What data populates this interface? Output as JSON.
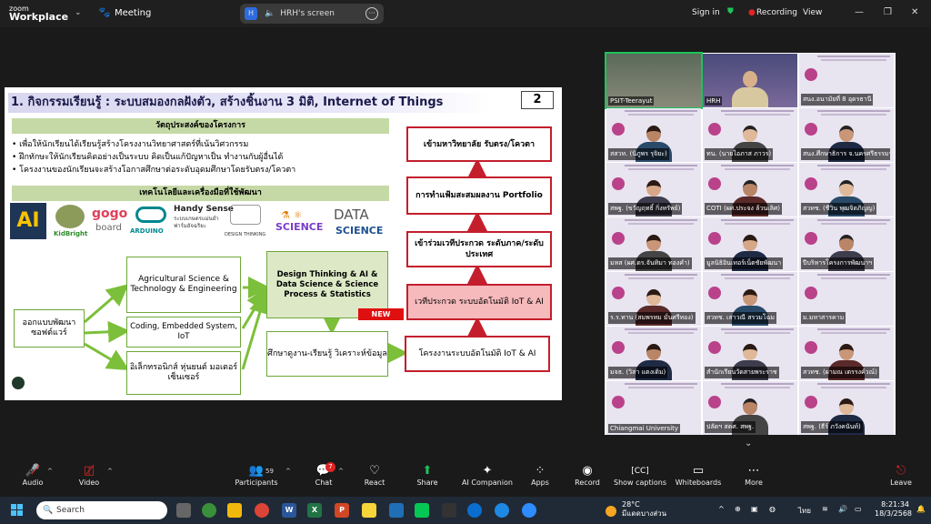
{
  "app": {
    "logo_line1": "zoom",
    "logo_line2": "Workplace",
    "meeting_label": "Meeting"
  },
  "screen_pill": {
    "badge": "H",
    "label": "HRH's screen",
    "more": "···"
  },
  "topright": {
    "sign_in": "Sign in",
    "recording": "Recording",
    "view": "View"
  },
  "slide": {
    "title": "1. กิจกรรมเรียนรู้ : ระบบสมองกลฝังตัว, สร้างชิ้นงาน 3 มิติ, Internet of Things",
    "page_number": "2",
    "section1": "วัตถุประสงค์ของโครงการ",
    "bullets": [
      "• เพื่อให้นักเรียนได้เรียนรู้สร้างโครงงานวิทยาศาสตร์ที่เน้นวิศวกรรม",
      "• ฝึกทักษะให้นักเรียนคิดอย่างเป็นระบบ คิดเป็นแก้ปัญหาเป็น ทำงานกับผู้อื่นได้",
      "• โครงงานของนักเรียนจะสร้างโอกาสศึกษาต่อระดับอุดมศึกษาโดยรับตรง/โควตา"
    ],
    "section2": "เทคโนโลยีและเครื่องมือที่ใช้พัฒนา",
    "logos": {
      "ai": "AI",
      "kidbright": "KidBright",
      "gogo": "gogo",
      "board": "board",
      "arduino": "ARDUINO",
      "handy": "Handy Sense",
      "handy_sub": "ระบบเกษตรแม่นยำ ฟาร์มอัจฉริยะ",
      "dt": "DESIGN THINKING",
      "science": "SCIENCE",
      "data": "DATA",
      "data_sci": "SCIENCE"
    },
    "flow": {
      "design_sw": "ออกแบบพัฒนา ซอฟต์แวร์",
      "agri": "Agricultural Science & Technology & Engineering",
      "coding": "Coding, Embedded System, IoT",
      "electronics": "อิเล็กทรอนิกส์ หุ่นยนต์ มอเตอร์ เซ็นเซอร์",
      "design_thinking": "Design Thinking & AI & Data Science & Science Process & Statistics",
      "new": "NEW",
      "study": "ศึกษาดูงาน-เรียนรู้ วิเคราะห์ข้อมูล",
      "project": "โครงงานระบบอัตโนมัติ IoT & AI",
      "contest_auto": "เวทีประกวด ระบบอัตโนมัติ IoT & AI",
      "contest_level": "เข้าร่วมเวทีประกวด ระดับภาค/ระดับประเทศ",
      "portfolio": "การทำแฟ้มสะสมผลงาน Portfolio",
      "university": "เข้ามหาวิทยาลัย รับตรง/โควตา"
    }
  },
  "gallery": [
    {
      "name": "PSIT-Teerayut",
      "kind": "room"
    },
    {
      "name": "HRH",
      "kind": "room2"
    },
    {
      "name": "สนง.อนามัยที่ 8 อุดรธานี",
      "kind": "slide"
    },
    {
      "name": "สสวท. (นิภูพร รุจิยะ)",
      "kind": "woman"
    },
    {
      "name": "ทน. (นายไอภาส ภาวร)",
      "kind": "man"
    },
    {
      "name": "สนง.ศึกษาธิการ จ.นครศรีธรรมราช",
      "kind": "man"
    },
    {
      "name": "สพฐ. (ขวัญฤทธิ์ กิ่งทรัพย์)",
      "kind": "woman"
    },
    {
      "name": "COTI (ผศ.ประจง ล้วนเลิศ)",
      "kind": "man"
    },
    {
      "name": "สวทช. (ชีวิน พุฒจิตภิญญ)",
      "kind": "man"
    },
    {
      "name": "มหส (ผศ.ดร.จันทิมา ทองคำ)",
      "kind": "woman"
    },
    {
      "name": "มูลนิธิอินเทอร์เน็ตชัยพัฒนา",
      "kind": "woman"
    },
    {
      "name": "ปีบริหารโครงการพัฒนาฯ",
      "kind": "man"
    },
    {
      "name": "ร.ร.ทาน (สมพรหม มั่นศรีทอง)",
      "kind": "woman"
    },
    {
      "name": "สวทช. เสาวณี สรวมโฉม",
      "kind": "woman"
    },
    {
      "name": "ม.มหาสารคาม",
      "kind": "slide"
    },
    {
      "name": "มจธ. (วิสา แตงเดิม)",
      "kind": "woman"
    },
    {
      "name": "สำนักเรียนวัดสายพระราช",
      "kind": "woman"
    },
    {
      "name": "สวทช. (ผามณ เตรรงค์วณ์)",
      "kind": "woman"
    },
    {
      "name": "Chiangmai University",
      "kind": "slide"
    },
    {
      "name": "ปลัดฯ สดศ. สพฐ.",
      "kind": "man"
    },
    {
      "name": "สพฐ. (ธีร์ ภวังคนันท์)",
      "kind": "woman"
    }
  ],
  "toolbar": {
    "audio": "Audio",
    "video": "Video",
    "participants": "Participants",
    "participants_count": "59",
    "chat": "Chat",
    "chat_badge": "7",
    "react": "React",
    "share": "Share",
    "ai_companion": "AI Companion",
    "apps": "Apps",
    "record": "Record",
    "captions": "Show captions",
    "whiteboards": "Whiteboards",
    "more": "More",
    "leave": "Leave"
  },
  "taskbar": {
    "search_placeholder": "Search",
    "temp": "28°C",
    "weather": "มีแดดบางส่วน",
    "lang": "ไทย",
    "time": "8:21:34",
    "date": "18/3/2568"
  },
  "colors": {
    "accent_green": "#6da73a",
    "accent_red": "#c41e2c",
    "recording_red": "#e02424"
  }
}
